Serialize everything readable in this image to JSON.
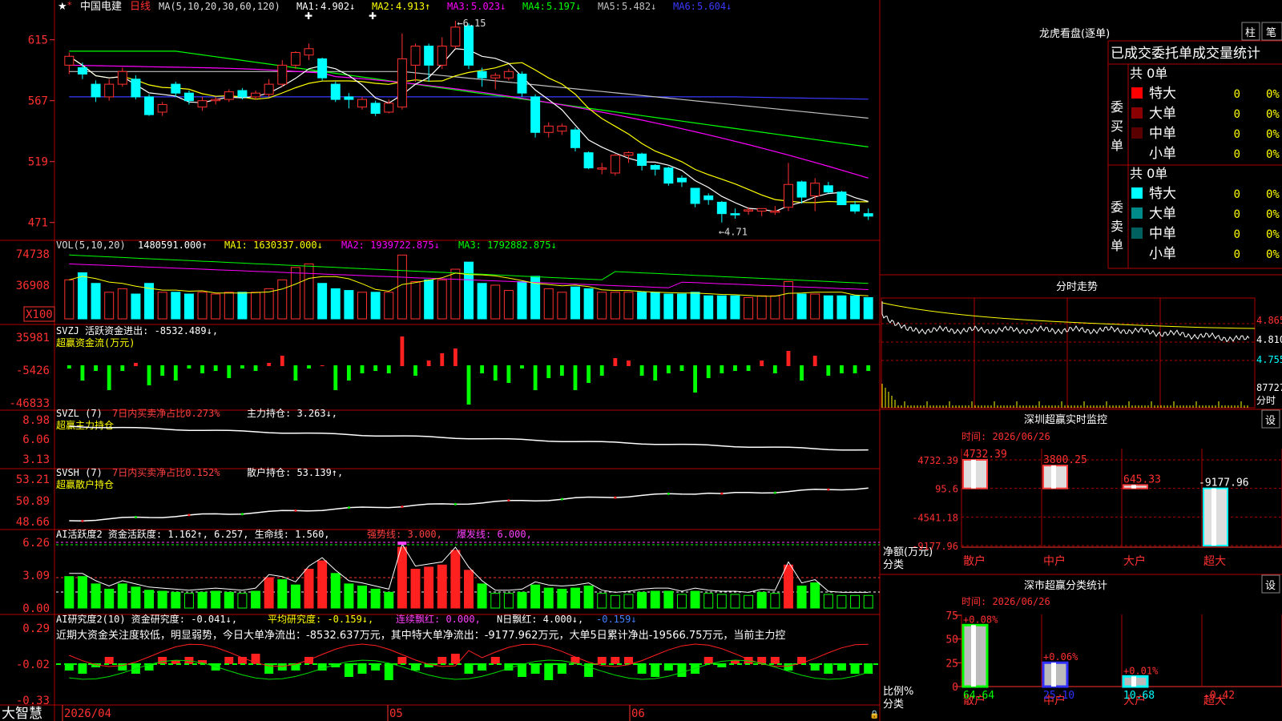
{
  "app": {
    "brand": "大智慧",
    "date_label": "2026/04"
  },
  "stock": {
    "name": "中国电建",
    "period": "日线"
  },
  "ma_header": {
    "params": "MA(5,10,20,30,60,120)",
    "items": [
      {
        "label": "MA1:",
        "value": "4.902↓",
        "color": "#ffffff"
      },
      {
        "label": "MA2:",
        "value": "4.913↑",
        "color": "#ffff00"
      },
      {
        "label": "MA3:",
        "value": "5.023↓",
        "color": "#ff00ff"
      },
      {
        "label": "MA4:",
        "value": "5.197↓",
        "color": "#00ff00"
      },
      {
        "label": "MA5:",
        "value": "5.482↓",
        "color": "#c0c0c0"
      },
      {
        "label": "MA6:",
        "value": "5.604↓",
        "color": "#3a3aff"
      }
    ]
  },
  "vol_header": {
    "params": "VOL(5,10,20)",
    "value": "1480591.000↑",
    "items": [
      {
        "text": "MA1: 1630337.000↓",
        "color": "#ffff00"
      },
      {
        "text": "MA2: 1939722.875↓",
        "color": "#ff00ff"
      },
      {
        "text": "MA3: 1792882.875↓",
        "color": "#00ff00"
      }
    ]
  },
  "svzj_header": {
    "line1": "SVZJ  活跃资金进出: -8532.489↓,",
    "line2": "超赢资金流(万元)"
  },
  "svzl_header": {
    "p1": "SVZL (7)",
    "p2": "7日内买卖净占比0.273%",
    "p3": "主力持仓: 3.263↓,",
    "line2": "超赢主力持仓"
  },
  "svsh_header": {
    "p1": "SVSH (7)",
    "p2": "7日内买卖净占比0.152%",
    "p3": "散户持仓: 53.139↑,",
    "line2": "超赢散户持仓"
  },
  "ai_active_header": {
    "p1": "AI活跃度2 资金活跃度: 1.162↑, 6.257, 生命线: 1.560,",
    "p2": "强势线: 3.000,",
    "p3": "爆发线: 6.000,"
  },
  "ai_research_header": {
    "p1": "AI研究度2(10) 资金研究度: -0.041↓,",
    "p2": "平均研究度: -0.159↓,",
    "p3": "连续飘红: 0.000,",
    "p4": "N日飘红: 4.000↓,",
    "p5": "-0.159↓"
  },
  "commentary": "近期大资金关注度较低，明显弱势，今日大单净流出：-8532.637万元，其中特大单净流出：-9177.962万元，大单5日累计净出-19566.75万元，当前主力控",
  "chart_data": {
    "type": "candlestick",
    "dates_axis": [
      "2026/04",
      "05",
      "06"
    ],
    "price_ticks": [
      "615",
      "567",
      "519",
      "471"
    ],
    "annotations": {
      "high": "6.15",
      "low": "4.71"
    },
    "candles": [
      [
        5.95,
        6.02,
        5.88,
        6.05
      ],
      [
        5.93,
        5.88,
        5.84,
        5.97
      ],
      [
        5.8,
        5.7,
        5.66,
        5.83
      ],
      [
        5.7,
        5.8,
        5.67,
        5.84
      ],
      [
        5.8,
        5.9,
        5.78,
        5.93
      ],
      [
        5.84,
        5.7,
        5.68,
        5.87
      ],
      [
        5.7,
        5.56,
        5.55,
        5.72
      ],
      [
        5.58,
        5.64,
        5.55,
        5.66
      ],
      [
        5.8,
        5.73,
        5.7,
        5.82
      ],
      [
        5.73,
        5.67,
        5.64,
        5.75
      ],
      [
        5.62,
        5.67,
        5.59,
        5.7
      ],
      [
        5.67,
        5.68,
        5.64,
        5.7
      ],
      [
        5.68,
        5.74,
        5.66,
        5.76
      ],
      [
        5.75,
        5.7,
        5.68,
        5.77
      ],
      [
        5.7,
        5.73,
        5.68,
        5.75
      ],
      [
        5.72,
        5.8,
        5.7,
        5.84
      ],
      [
        5.8,
        5.95,
        5.78,
        5.99
      ],
      [
        5.95,
        6.05,
        5.92,
        6.06
      ],
      [
        6.03,
        6.08,
        5.99,
        6.12
      ],
      [
        6.0,
        5.85,
        5.83,
        6.01
      ],
      [
        5.8,
        5.68,
        5.66,
        5.82
      ],
      [
        5.7,
        5.68,
        5.61,
        5.73
      ],
      [
        5.62,
        5.68,
        5.6,
        5.7
      ],
      [
        5.65,
        5.57,
        5.55,
        5.67
      ],
      [
        5.58,
        5.65,
        5.57,
        5.68
      ],
      [
        5.62,
        6.0,
        5.6,
        6.2
      ],
      [
        5.95,
        6.1,
        5.82,
        6.12
      ],
      [
        6.1,
        5.95,
        5.82,
        6.12
      ],
      [
        5.95,
        6.1,
        5.92,
        6.17
      ],
      [
        6.1,
        6.25,
        6.08,
        6.3
      ],
      [
        6.26,
        5.95,
        5.92,
        6.28
      ],
      [
        5.9,
        5.85,
        5.78,
        5.93
      ],
      [
        5.85,
        5.87,
        5.76,
        5.89
      ],
      [
        5.85,
        5.9,
        5.83,
        5.92
      ],
      [
        5.88,
        5.73,
        5.7,
        5.9
      ],
      [
        5.7,
        5.42,
        5.38,
        5.72
      ],
      [
        5.42,
        5.47,
        5.38,
        5.5
      ],
      [
        5.43,
        5.47,
        5.4,
        5.49
      ],
      [
        5.44,
        5.3,
        5.27,
        5.46
      ],
      [
        5.26,
        5.14,
        5.13,
        5.27
      ],
      [
        5.14,
        5.14,
        5.09,
        5.18
      ],
      [
        5.1,
        5.24,
        5.08,
        5.25
      ],
      [
        5.24,
        5.26,
        5.18,
        5.27
      ],
      [
        5.25,
        5.16,
        5.12,
        5.26
      ],
      [
        5.16,
        5.13,
        5.08,
        5.17
      ],
      [
        5.14,
        5.02,
        5.0,
        5.15
      ],
      [
        5.06,
        5.03,
        4.99,
        5.08
      ],
      [
        4.98,
        4.86,
        4.83,
        4.98
      ],
      [
        4.92,
        4.89,
        4.85,
        4.94
      ],
      [
        4.87,
        4.78,
        4.71,
        4.88
      ],
      [
        4.78,
        4.77,
        4.74,
        4.82
      ],
      [
        4.8,
        4.81,
        4.77,
        4.83
      ],
      [
        4.8,
        4.82,
        4.76,
        4.82
      ],
      [
        4.8,
        4.8,
        4.77,
        4.84
      ],
      [
        4.83,
        5.01,
        4.8,
        5.18
      ],
      [
        5.03,
        4.91,
        4.86,
        5.04
      ],
      [
        4.92,
        5.02,
        4.8,
        5.06
      ],
      [
        5.0,
        4.95,
        4.94,
        5.03
      ],
      [
        4.95,
        4.85,
        4.85,
        4.96
      ],
      [
        4.85,
        4.8,
        4.78,
        4.88
      ],
      [
        4.78,
        4.76,
        4.73,
        4.82
      ]
    ],
    "volume_ticks": [
      "74738",
      "36908",
      "X100"
    ],
    "svzj_ticks": [
      "35981",
      "-5426",
      "-46833"
    ],
    "svzl_ticks": [
      "8.98",
      "6.06",
      "3.13"
    ],
    "svsh_ticks": [
      "53.21",
      "50.89",
      "48.66"
    ],
    "ai_active_ticks": [
      "6.26",
      "3.09",
      "0.00"
    ],
    "ai_research_ticks": [
      "0.29",
      "-0.02",
      "-0.33"
    ],
    "intraday_ticks": [
      "4.865",
      "4.810",
      "4.755",
      "87727",
      "分时"
    ]
  },
  "right": {
    "dragon_title": "龙虎看盘(逐单)",
    "tab1": "柱",
    "tab2": "笔",
    "section_title": "已成交委托单成交量统计",
    "buy_side": {
      "label": "委买单",
      "total": "共 0单",
      "rows": [
        {
          "name": "特大",
          "count": "0",
          "pct": "0%",
          "color": "#ff0000"
        },
        {
          "name": "大单",
          "count": "0",
          "pct": "0%",
          "color": "#8b0000"
        },
        {
          "name": "中单",
          "count": "0",
          "pct": "0%",
          "color": "#5a0000"
        },
        {
          "name": "小单",
          "count": "0",
          "pct": "0%",
          "color": "none"
        }
      ]
    },
    "sell_side": {
      "label": "委卖单",
      "total": "共 0单",
      "rows": [
        {
          "name": "特大",
          "count": "0",
          "pct": "0%",
          "color": "#00ffff"
        },
        {
          "name": "大单",
          "count": "0",
          "pct": "0%",
          "color": "#008b8b"
        },
        {
          "name": "中单",
          "count": "0",
          "pct": "0%",
          "color": "#006060"
        },
        {
          "name": "小单",
          "count": "0",
          "pct": "0%",
          "color": "none"
        }
      ]
    },
    "intraday_title": "分时走势",
    "monitor": {
      "title": "深圳超赢实时监控",
      "settings": "设",
      "time": "时间: 2026/06/26",
      "y_ticks": [
        "4732.39",
        "95.6",
        "-4541.18",
        "-9177.96"
      ],
      "ylabel": "净额(万元)",
      "xlabel": "分类",
      "categories": [
        "散户",
        "中户",
        "大户",
        "超大"
      ],
      "values": [
        4732.39,
        3800.25,
        645.33,
        -9177.96
      ],
      "value_labels": [
        "4732.39",
        "3800.25",
        "645.33",
        "-9177.96"
      ]
    },
    "classify": {
      "title": "深市超赢分类统计",
      "settings": "设",
      "time": "时间: 2026/06/26",
      "y_ticks": [
        "75",
        "50",
        "25",
        "0"
      ],
      "ylabel": "比例%",
      "xlabel": "分类",
      "categories": [
        "散户",
        "中户",
        "大户",
        "超大"
      ],
      "values": [
        64.64,
        25.1,
        10.68,
        -0.42
      ],
      "value_labels": [
        "64.64",
        "25.10",
        "10.68",
        "-0.42"
      ],
      "delta_labels": [
        "+0.08%",
        "+0.06%",
        "+0.01%",
        ""
      ]
    }
  }
}
